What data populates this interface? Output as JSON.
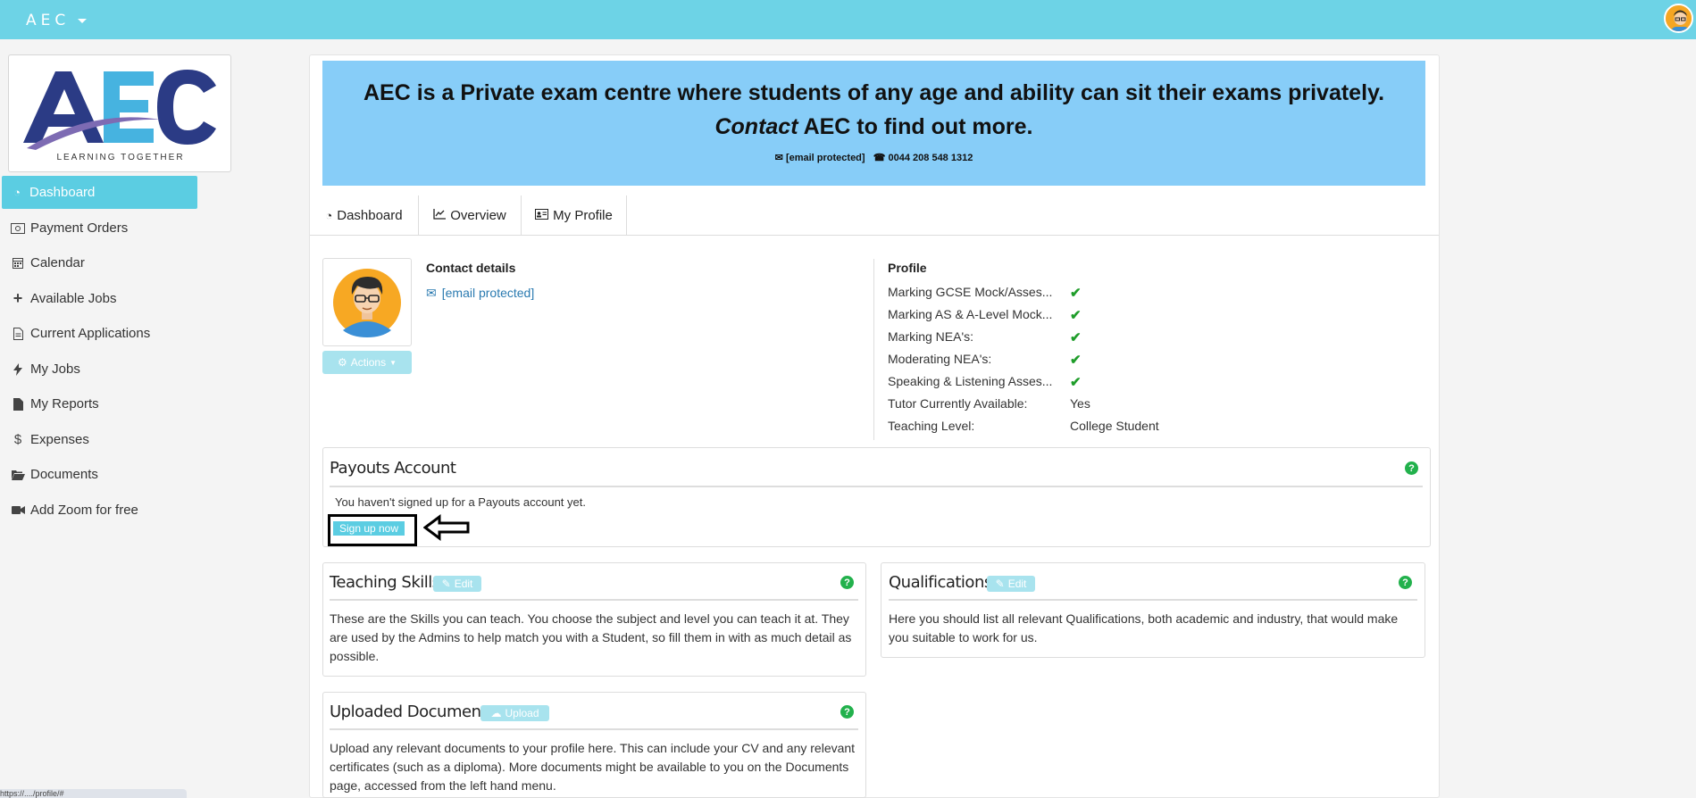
{
  "app": {
    "brand": "AEC",
    "logo": {
      "text": "AEC",
      "tagline": "LEARNING TOGETHER"
    }
  },
  "sidebar": {
    "items": [
      {
        "label": "Dashboard",
        "icon": "dashboard-icon",
        "active": true
      },
      {
        "label": "Payment Orders",
        "icon": "money-icon"
      },
      {
        "label": "Calendar",
        "icon": "calendar-icon"
      },
      {
        "label": "Available Jobs",
        "icon": "plus-icon"
      },
      {
        "label": "Current Applications",
        "icon": "document-icon"
      },
      {
        "label": "My Jobs",
        "icon": "bolt-icon"
      },
      {
        "label": "My Reports",
        "icon": "file-icon"
      },
      {
        "label": "Expenses",
        "icon": "dollar-icon"
      },
      {
        "label": "Documents",
        "icon": "folder-open-icon"
      },
      {
        "label": "Add Zoom for free",
        "icon": "video-icon"
      }
    ]
  },
  "banner": {
    "line1": "AEC is a Private exam centre where students of any age and ability can sit their exams privately.",
    "line2_em": "Contact",
    "line2_rest": "AEC to find out more.",
    "email": "[email protected]",
    "phone": "0044 208 548 1312"
  },
  "tabs": [
    {
      "label": "Dashboard",
      "icon": "dashboard-icon"
    },
    {
      "label": "Overview",
      "icon": "line-chart-icon"
    },
    {
      "label": "My Profile",
      "icon": "id-card-icon"
    }
  ],
  "profile_card": {
    "actions_label": "Actions"
  },
  "contact": {
    "title": "Contact details",
    "email": "[email protected]"
  },
  "profile": {
    "title": "Profile",
    "rows": [
      {
        "label": "Marking GCSE Mock/Asses...",
        "value": "✔"
      },
      {
        "label": "Marking AS & A-Level Mock...",
        "value": "✔"
      },
      {
        "label": "Marking NEA's:",
        "value": "✔"
      },
      {
        "label": "Moderating NEA's:",
        "value": "✔"
      },
      {
        "label": "Speaking & Listening Asses...",
        "value": "✔"
      },
      {
        "label": "Tutor Currently Available:",
        "value": "Yes"
      },
      {
        "label": "Teaching Level:",
        "value": "College Student"
      }
    ]
  },
  "payouts": {
    "title": "Payouts Account",
    "message": "You haven't signed up for a Payouts account yet.",
    "button": "Sign up now",
    "arrow": "⇦"
  },
  "teaching_skills": {
    "title": "Teaching Skills",
    "button": "Edit",
    "text": "These are the Skills you can teach. You choose the subject and level you can teach it at. They are used by the Admins to help match you with a Student, so fill them in with as much detail as possible."
  },
  "qualifications": {
    "title": "Qualifications",
    "button": "Edit",
    "text": "Here you should list all relevant Qualifications, both academic and industry, that would make you suitable to work for us."
  },
  "uploaded_documents": {
    "title": "Uploaded Documents",
    "button": "Upload",
    "text": "Upload any relevant documents to your profile here. This can include your CV and any relevant certificates (such as a diploma). More documents might be available to you on the Documents page, accessed from the left hand menu."
  },
  "status_bar": {
    "url": "https://..../profile/#"
  }
}
